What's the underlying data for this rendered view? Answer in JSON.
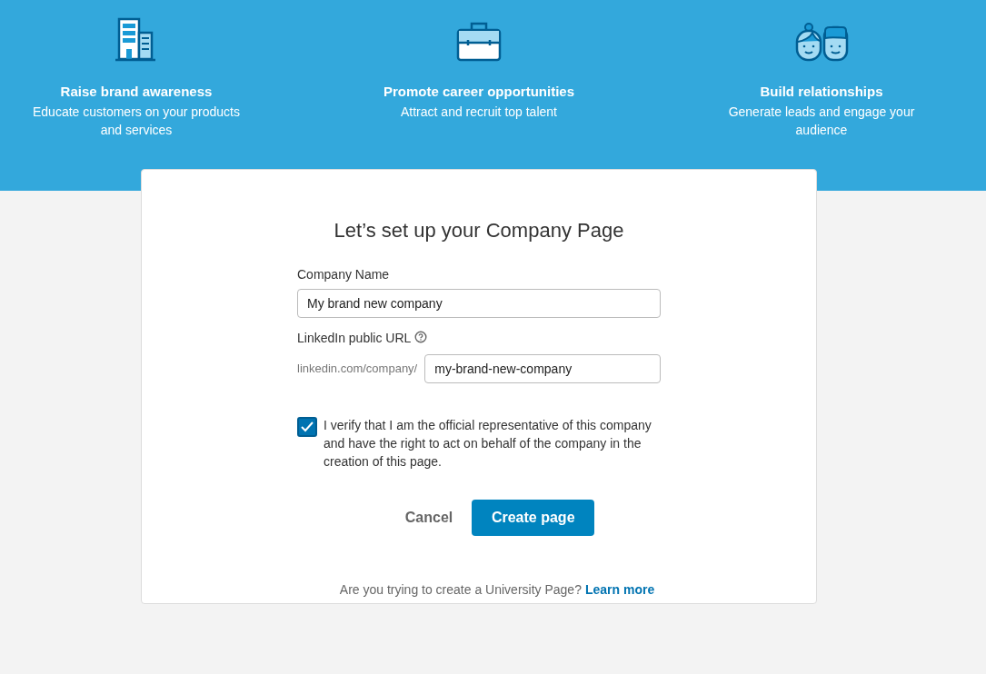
{
  "features": [
    {
      "kind": "building",
      "title": "Raise brand awareness",
      "description": "Educate customers on your products and services"
    },
    {
      "kind": "briefcase",
      "title": "Promote career opportunities",
      "description": "Attract and recruit top talent"
    },
    {
      "kind": "people",
      "title": "Build relationships",
      "description": "Generate leads and engage your audience"
    }
  ],
  "form": {
    "title": "Let’s set up your Company Page",
    "company_name": {
      "label": "Company Name",
      "value": "My brand new company"
    },
    "public_url": {
      "label": "LinkedIn public URL",
      "prefix": "linkedin.com/company/",
      "value": "my-brand-new-company"
    },
    "verify": {
      "checked": true,
      "text": "I verify that I am the official representative of this company and have the right to act on behalf of the company in the creation of this page."
    },
    "buttons": {
      "cancel": "Cancel",
      "create": "Create page"
    },
    "footer": {
      "text": "Are you trying to create a University Page?",
      "link": "Learn more"
    }
  }
}
